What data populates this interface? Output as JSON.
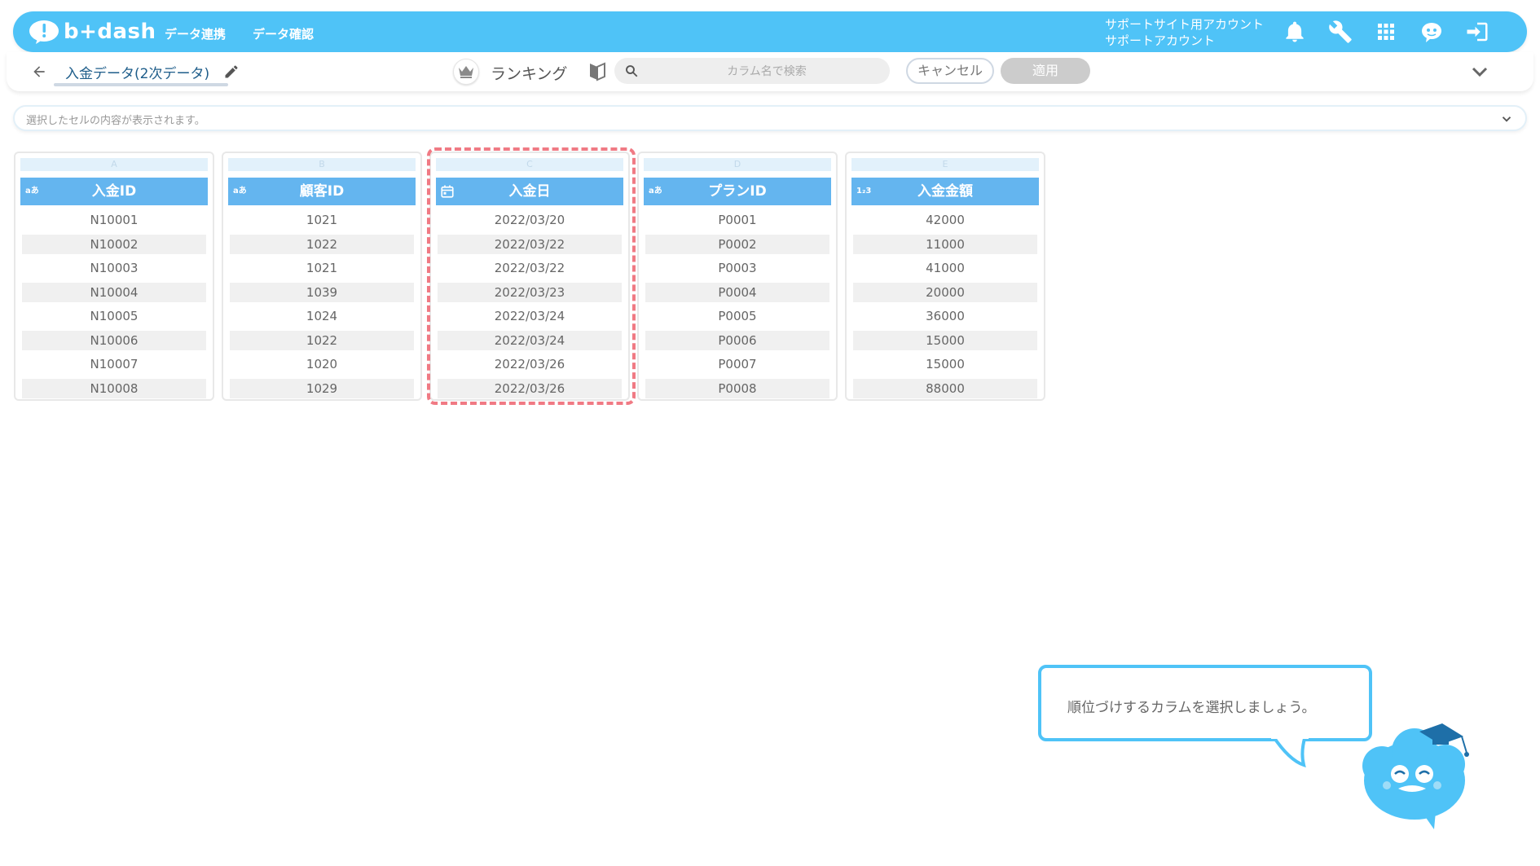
{
  "header": {
    "logo_text": "b+dash",
    "nav": [
      {
        "label": "データ連携"
      },
      {
        "label": "データ確認"
      }
    ],
    "account_line1": "サポートサイト用アカウント",
    "account_line2": "サポートアカウント",
    "icons": [
      "bell-icon",
      "wrench-icon",
      "grid-icon",
      "support-icon",
      "logout-icon"
    ]
  },
  "toolbar": {
    "data_title": "入金データ(2次データ)",
    "ranking_label": "ランキング",
    "search_placeholder": "カラム名で検索",
    "cancel_label": "キャンセル",
    "apply_label": "適用"
  },
  "cellbar": {
    "placeholder": "選択したセルの内容が表示されます。"
  },
  "columns": [
    {
      "letter": "A",
      "type": "aあ",
      "name": "入金ID",
      "rows": [
        "N10001",
        "N10002",
        "N10003",
        "N10004",
        "N10005",
        "N10006",
        "N10007",
        "N10008"
      ]
    },
    {
      "letter": "B",
      "type": "aあ",
      "name": "顧客ID",
      "rows": [
        "1021",
        "1022",
        "1021",
        "1039",
        "1024",
        "1022",
        "1020",
        "1029"
      ]
    },
    {
      "letter": "C",
      "type": "calendar-icon",
      "name": "入金日",
      "rows": [
        "2022/03/20",
        "2022/03/22",
        "2022/03/22",
        "2022/03/23",
        "2022/03/24",
        "2022/03/24",
        "2022/03/26",
        "2022/03/26"
      ]
    },
    {
      "letter": "D",
      "type": "aあ",
      "name": "プランID",
      "rows": [
        "P0001",
        "P0002",
        "P0003",
        "P0004",
        "P0005",
        "P0006",
        "P0007",
        "P0008"
      ]
    },
    {
      "letter": "E",
      "type": "1₂3",
      "name": "入金金額",
      "rows": [
        "42000",
        "11000",
        "41000",
        "20000",
        "36000",
        "15000",
        "15000",
        "88000"
      ]
    }
  ],
  "tooltip": {
    "message": "順位づけするカラムを選択しましょう。"
  },
  "colors": {
    "brand": "#4fc3f7",
    "column_header": "#64b5ef",
    "highlight": "#f07a84"
  }
}
